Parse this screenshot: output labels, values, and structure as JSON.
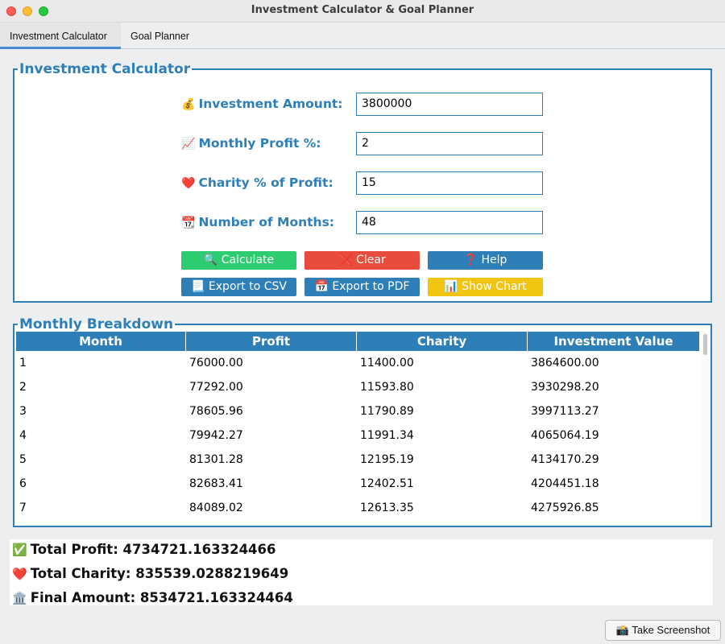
{
  "window": {
    "title": "Investment Calculator & Goal Planner"
  },
  "tabs": [
    {
      "label": "Investment Calculator"
    },
    {
      "label": "Goal Planner"
    }
  ],
  "calculator": {
    "legend": "Investment Calculator",
    "fields": [
      {
        "icon": "💰",
        "label": "Investment Amount:",
        "value": "3800000"
      },
      {
        "icon": "📈",
        "label": "Monthly Profit %:",
        "value": "2"
      },
      {
        "icon": "❤️",
        "label": "Charity % of Profit:",
        "value": "15"
      },
      {
        "icon": "📆",
        "label": "Number of Months:",
        "value": "48"
      }
    ],
    "buttons": {
      "calculate": "🔍 Calculate",
      "clear": "❌ Clear",
      "help": "❓ Help",
      "export_csv": "📃 Export to CSV",
      "export_pdf": "📅 Export to PDF",
      "show_chart": "📊 Show Chart"
    },
    "colors": {
      "accent": "#2e7fb8",
      "green": "#2ecc71",
      "red": "#e74c3c",
      "yellow": "#f1c40f"
    }
  },
  "breakdown": {
    "legend": "Monthly Breakdown",
    "columns": [
      "Month",
      "Profit",
      "Charity",
      "Investment Value"
    ],
    "rows": [
      [
        "1",
        "76000.00",
        "11400.00",
        "3864600.00"
      ],
      [
        "2",
        "77292.00",
        "11593.80",
        "3930298.20"
      ],
      [
        "3",
        "78605.96",
        "11790.89",
        "3997113.27"
      ],
      [
        "4",
        "79942.27",
        "11991.34",
        "4065064.19"
      ],
      [
        "5",
        "81301.28",
        "12195.19",
        "4134170.29"
      ],
      [
        "6",
        "82683.41",
        "12402.51",
        "4204451.18"
      ],
      [
        "7",
        "84089.02",
        "12613.35",
        "4275926.85"
      ]
    ]
  },
  "summary": {
    "total_profit": {
      "icon": "✅",
      "text": "Total Profit: 4734721.163324466"
    },
    "total_charity": {
      "icon": "❤️",
      "text": "Total Charity: 835539.0288219649"
    },
    "final_amount": {
      "icon": "🏛️",
      "text": "Final Amount: 8534721.163324464"
    }
  },
  "footer": {
    "screenshot_button": "📸 Take Screenshot"
  }
}
